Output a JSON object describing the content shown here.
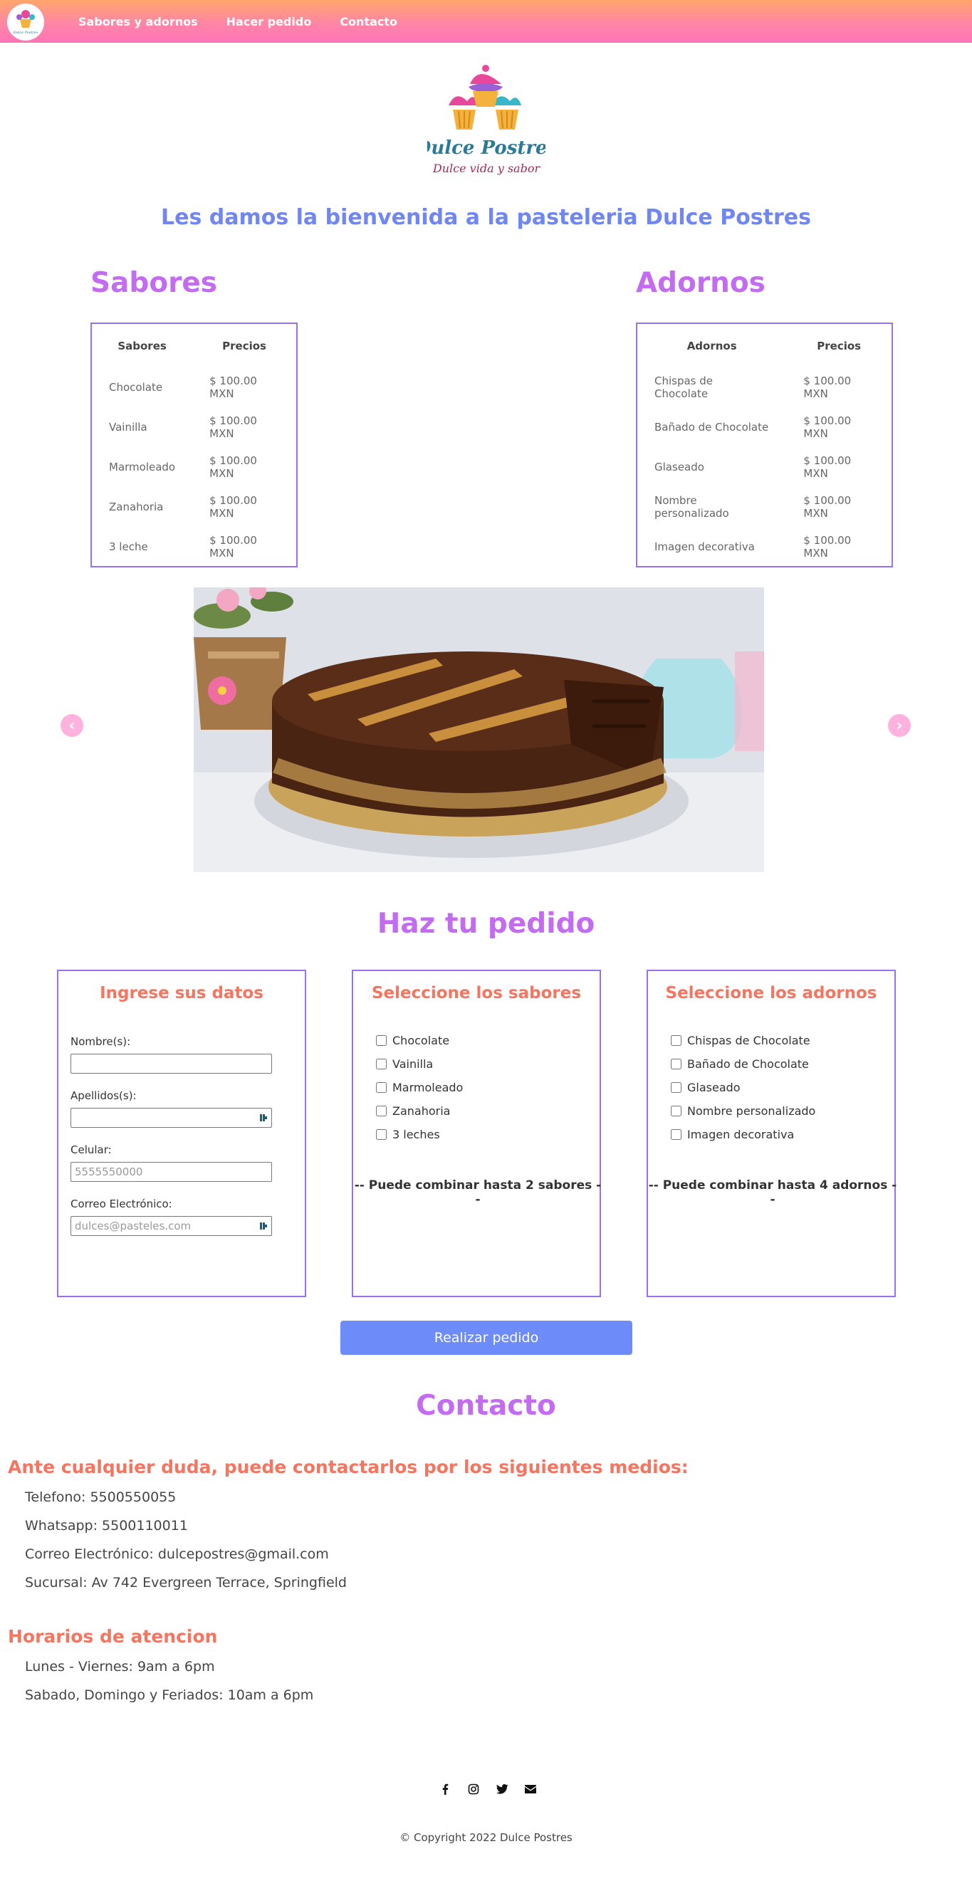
{
  "nav": {
    "logo_text": "Dulce Postres",
    "links": [
      "Sabores y adornos",
      "Hacer pedido",
      "Contacto"
    ]
  },
  "hero": {
    "logo_brand": "Dulce Postres",
    "logo_tagline": "Dulce vida y sabor",
    "welcome": "Les damos la bienvenida a la pasteleria Dulce Postres"
  },
  "sabores": {
    "title": "Sabores",
    "headers": [
      "Sabores",
      "Precios"
    ],
    "rows": [
      [
        "Chocolate",
        "$ 100.00 MXN"
      ],
      [
        "Vainilla",
        "$ 100.00 MXN"
      ],
      [
        "Marmoleado",
        "$ 100.00 MXN"
      ],
      [
        "Zanahoria",
        "$ 100.00 MXN"
      ],
      [
        "3 leche",
        "$ 100.00 MXN"
      ]
    ]
  },
  "adornos": {
    "title": "Adornos",
    "headers": [
      "Adornos",
      "Precios"
    ],
    "rows": [
      [
        "Chispas de Chocolate",
        "$ 100.00 MXN"
      ],
      [
        "Bañado de Chocolate",
        "$ 100.00 MXN"
      ],
      [
        "Glaseado",
        "$ 100.00 MXN"
      ],
      [
        "Nombre personalizado",
        "$ 100.00 MXN"
      ],
      [
        "Imagen decorativa",
        "$ 100.00 MXN"
      ]
    ]
  },
  "carousel": {
    "prev": "‹",
    "next": "›"
  },
  "order": {
    "title": "Haz tu pedido",
    "datos": {
      "title": "Ingrese sus datos",
      "fields": [
        {
          "label": "Nombre(s):",
          "placeholder": ""
        },
        {
          "label": "Apellidos(s):",
          "placeholder": ""
        },
        {
          "label": "Celular:",
          "placeholder": "5555550000"
        },
        {
          "label": "Correo Electrónico:",
          "placeholder": "dulces@pasteles.com"
        }
      ]
    },
    "sabores": {
      "title": "Seleccione los sabores",
      "options": [
        "Chocolate",
        "Vainilla",
        "Marmoleado",
        "Zanahoria",
        "3 leches"
      ],
      "note": "-- Puede combinar hasta 2 sabores --"
    },
    "adornos": {
      "title": "Seleccione los adornos",
      "options": [
        "Chispas de Chocolate",
        "Bañado de Chocolate",
        "Glaseado",
        "Nombre personalizado",
        "Imagen decorativa"
      ],
      "note": "-- Puede combinar hasta 4 adornos --"
    },
    "submit": "Realizar pedido"
  },
  "contact": {
    "title": "Contacto",
    "intro": "Ante cualquier duda, puede contactarlos por los siguientes medios:",
    "lines": [
      "Telefono: 5500550055",
      "Whatsapp: 5500110011",
      "Correo Electrónico: dulcepostres@gmail.com",
      "Sucursal: Av 742 Evergreen Terrace, Springfield"
    ],
    "hours_title": "Horarios de atencion",
    "hours": [
      "Lunes - Viernes: 9am a 6pm",
      "Sabado, Domingo y Feriados: 10am a 6pm"
    ]
  },
  "footer": {
    "icons": [
      "facebook-icon",
      "instagram-icon",
      "twitter-icon",
      "envelope-icon"
    ],
    "copyright": "© Copyright 2022 Dulce Postres"
  },
  "colors": {
    "nav_gradient_top": "#ffa66b",
    "nav_gradient_bottom": "#ff74b8",
    "accent_purple": "#c36cf2",
    "accent_blue": "#6f86f3",
    "accent_orange": "#f57560",
    "border_violet": "#9a70f2"
  }
}
